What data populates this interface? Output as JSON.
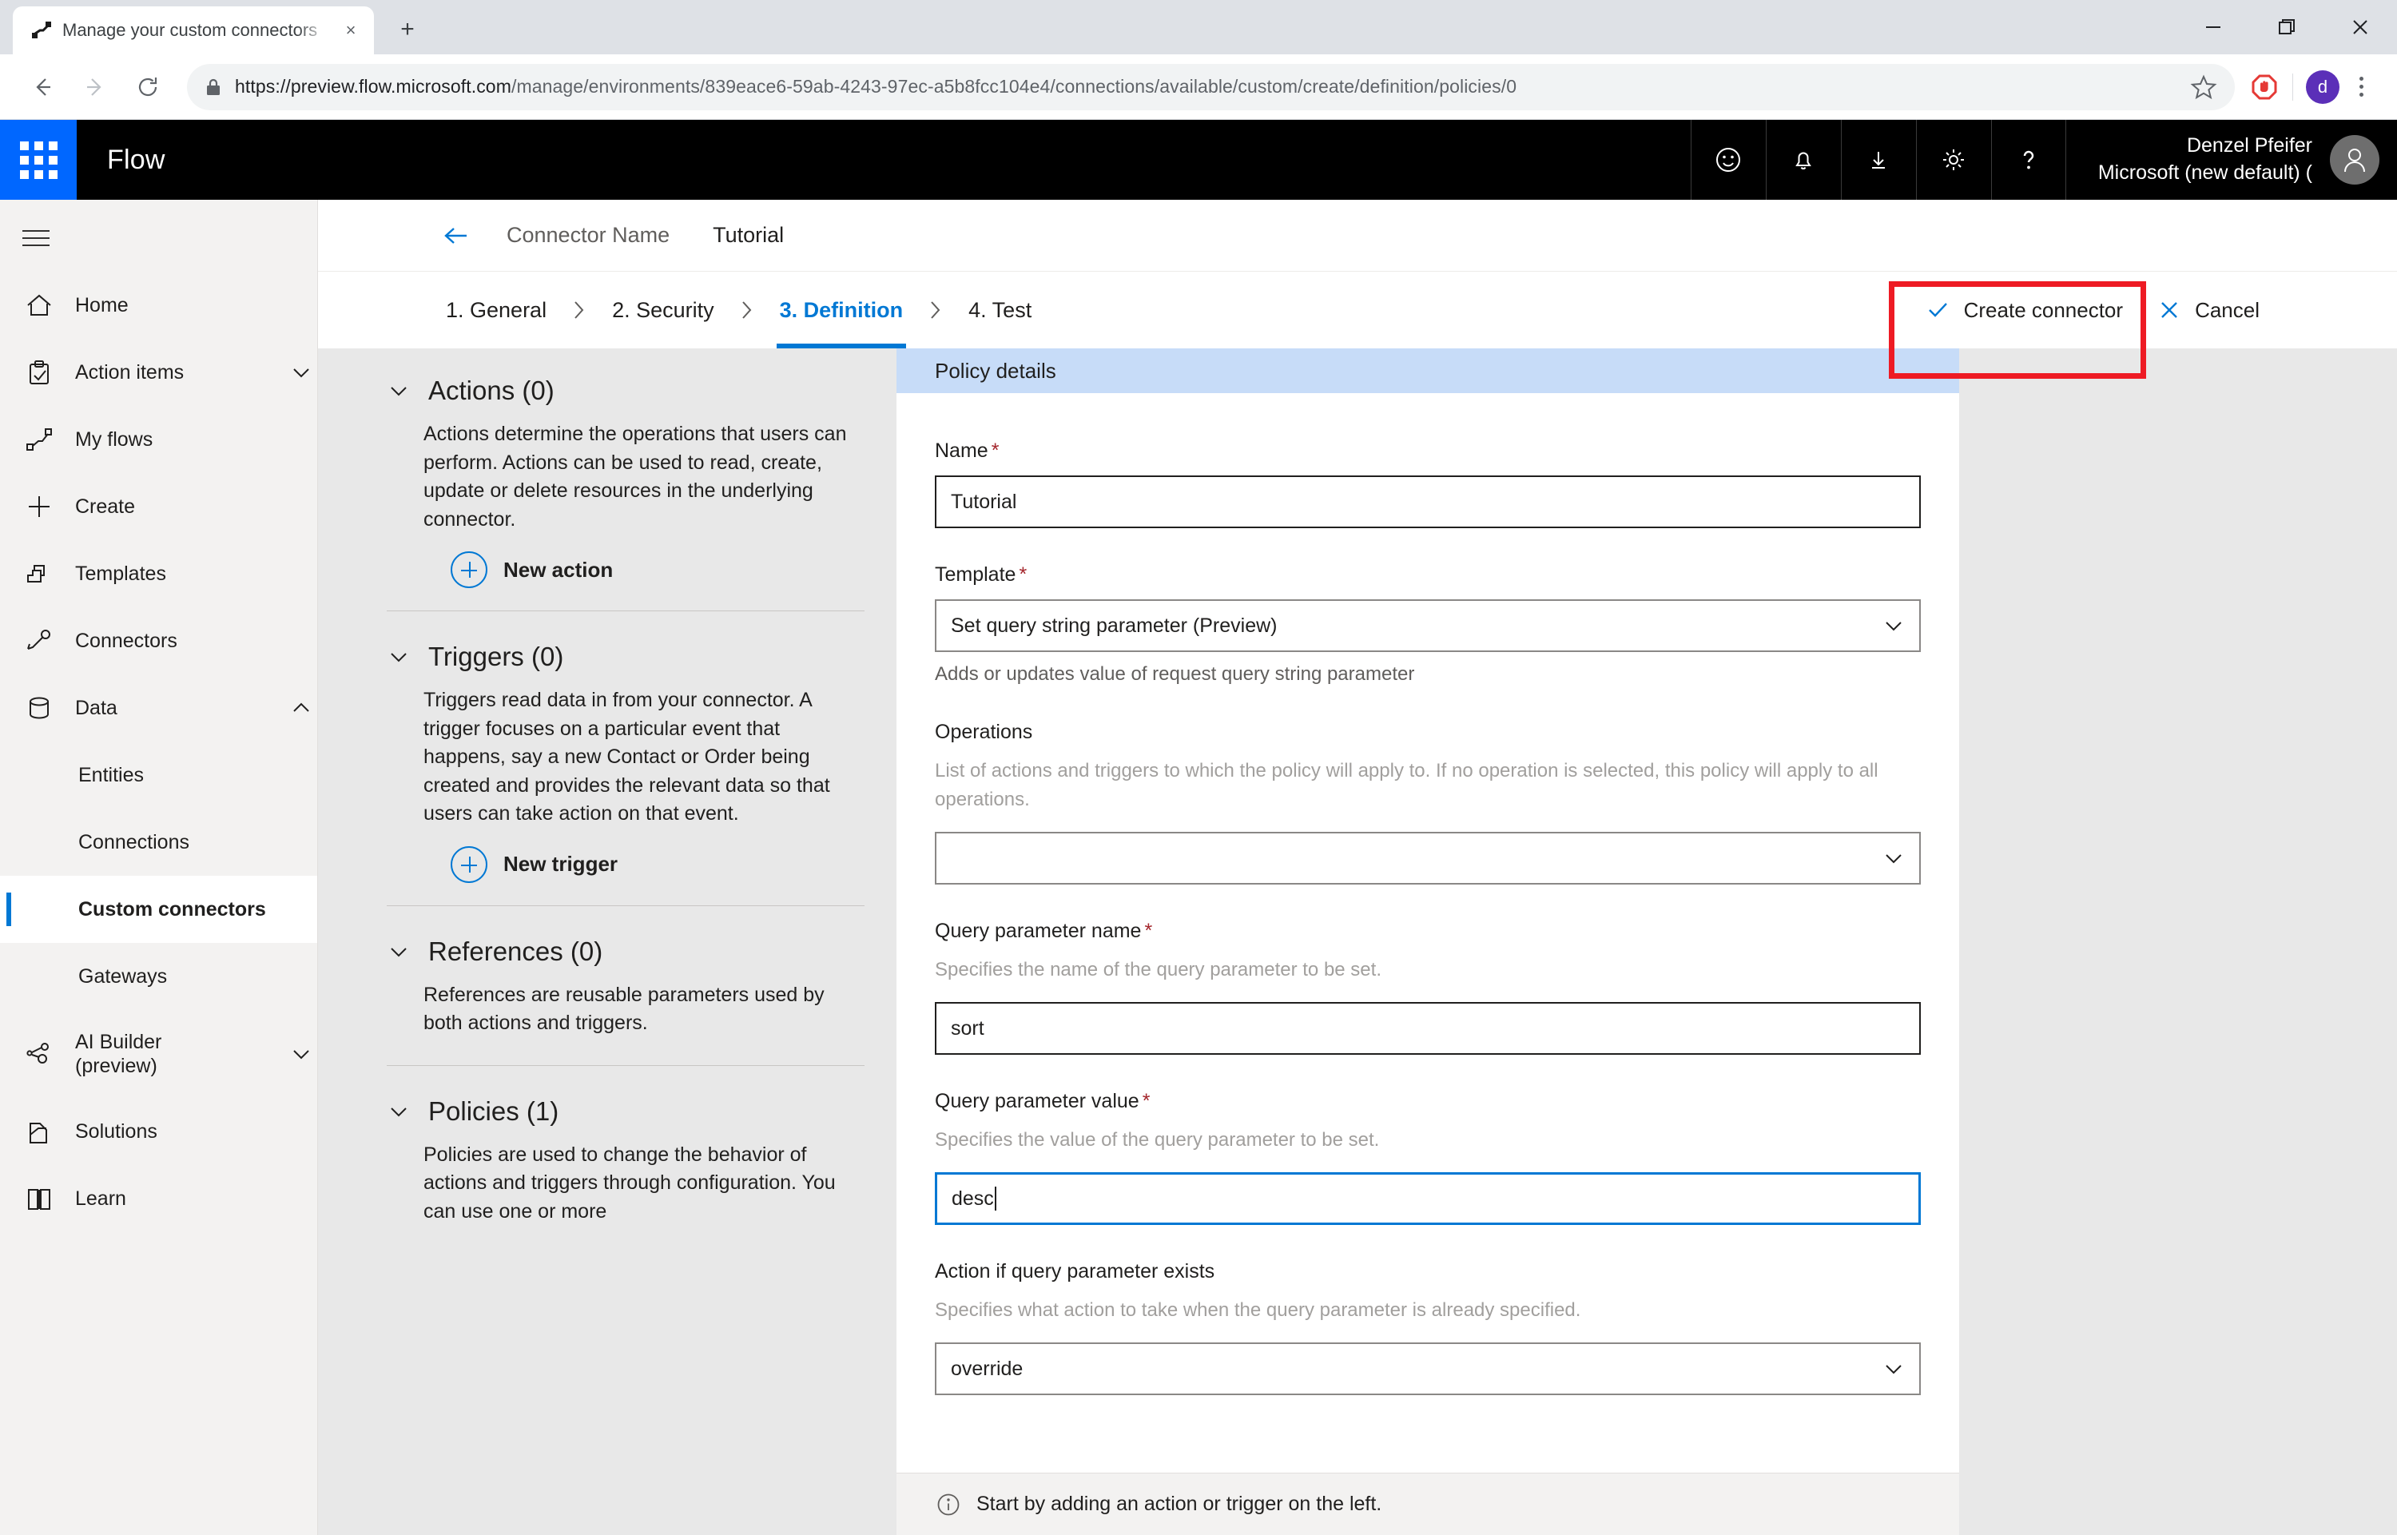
{
  "browser": {
    "tab": {
      "title": "Manage your custom connectors",
      "favicon": "flow-favicon",
      "close": "×"
    },
    "newtab_label": "+",
    "window_controls": {
      "minimize": "minimize-icon",
      "maximize": "maximize-icon",
      "close": "close-icon"
    },
    "url_scheme_domain": "https://preview.flow.microsoft.com",
    "url_path": "/manage/environments/839eace6-59ab-4243-97ec-a5b8fcc104e4/connections/available/custom/create/definition/policies/0",
    "profile_initial": "d"
  },
  "app_header": {
    "brand": "Flow",
    "icons": [
      "smiley-icon",
      "bell-icon",
      "download-icon",
      "gear-icon",
      "help-icon"
    ],
    "user_name": "Denzel Pfeifer",
    "user_org": "Microsoft (new default) ("
  },
  "sidebar": {
    "items": [
      {
        "label": "Home",
        "icon": "home-icon",
        "chevron": "",
        "selected": false,
        "sub": false
      },
      {
        "label": "Action items",
        "icon": "clipboard-check-icon",
        "chevron": "down",
        "selected": false,
        "sub": false
      },
      {
        "label": "My flows",
        "icon": "flow-icon",
        "chevron": "",
        "selected": false,
        "sub": false
      },
      {
        "label": "Create",
        "icon": "plus-icon",
        "chevron": "",
        "selected": false,
        "sub": false
      },
      {
        "label": "Templates",
        "icon": "templates-icon",
        "chevron": "",
        "selected": false,
        "sub": false
      },
      {
        "label": "Connectors",
        "icon": "connectors-icon",
        "chevron": "",
        "selected": false,
        "sub": false
      },
      {
        "label": "Data",
        "icon": "database-icon",
        "chevron": "up",
        "selected": false,
        "sub": false
      },
      {
        "label": "Entities",
        "icon": "",
        "chevron": "",
        "selected": false,
        "sub": true
      },
      {
        "label": "Connections",
        "icon": "",
        "chevron": "",
        "selected": false,
        "sub": true
      },
      {
        "label": "Custom connectors",
        "icon": "",
        "chevron": "",
        "selected": true,
        "sub": true
      },
      {
        "label": "Gateways",
        "icon": "",
        "chevron": "",
        "selected": false,
        "sub": true
      },
      {
        "label": "AI Builder (preview)",
        "icon": "ai-builder-icon",
        "chevron": "down",
        "selected": false,
        "sub": false
      },
      {
        "label": "Solutions",
        "icon": "solutions-icon",
        "chevron": "",
        "selected": false,
        "sub": false
      },
      {
        "label": "Learn",
        "icon": "book-icon",
        "chevron": "",
        "selected": false,
        "sub": false
      }
    ]
  },
  "breadcrumb": {
    "back_icon": "back-arrow-icon",
    "connector_label": "Connector Name",
    "connector_value": "Tutorial"
  },
  "steps": {
    "separator": "›",
    "items": [
      {
        "label": "1. General",
        "active": false
      },
      {
        "label": "2. Security",
        "active": false
      },
      {
        "label": "3. Definition",
        "active": true
      },
      {
        "label": "4. Test",
        "active": false
      }
    ]
  },
  "commands": {
    "create_label": "Create connector",
    "create_icon": "check-icon",
    "cancel_label": "Cancel",
    "cancel_icon": "close-x-icon",
    "highlight_color": "#ee1b24"
  },
  "left_pane": {
    "sections": [
      {
        "title": "Actions (0)",
        "description": "Actions determine the operations that users can perform. Actions can be used to read, create, update or delete resources in the underlying connector.",
        "button": "New action",
        "rule": true
      },
      {
        "title": "Triggers (0)",
        "description": "Triggers read data in from your connector. A trigger focuses on a particular event that happens, say a new Contact or Order being created and provides the relevant data so that users can take action on that event.",
        "button": "New trigger",
        "rule": true
      },
      {
        "title": "References (0)",
        "description": "References are reusable parameters used by both actions and triggers.",
        "button": "",
        "rule": true
      },
      {
        "title": "Policies (1)",
        "description": "Policies are used to change the behavior of actions and triggers through configuration. You can use one or more",
        "button": "",
        "rule": false
      }
    ]
  },
  "form": {
    "banner": "Policy details",
    "fields": [
      {
        "label": "Name",
        "required": true,
        "help": "",
        "type": "text",
        "value": "Tutorial",
        "focused": false,
        "sub": ""
      },
      {
        "label": "Template",
        "required": true,
        "help": "",
        "type": "select",
        "value": "Set query string parameter (Preview)",
        "focused": false,
        "sub": "Adds or updates value of request query string parameter"
      },
      {
        "label": "Operations",
        "required": false,
        "help": "List of actions and triggers to which the policy will apply to. If no operation is selected, this policy will apply to all operations.",
        "type": "select",
        "value": "",
        "focused": false,
        "sub": ""
      },
      {
        "label": "Query parameter name",
        "required": true,
        "help": "Specifies the name of the query parameter to be set.",
        "type": "text",
        "value": "sort",
        "focused": false,
        "sub": ""
      },
      {
        "label": "Query parameter value",
        "required": true,
        "help": "Specifies the value of the query parameter to be set.",
        "type": "text",
        "value": "desc",
        "focused": true,
        "sub": ""
      },
      {
        "label": "Action if query parameter exists",
        "required": false,
        "help": "Specifies what action to take when the query parameter is already specified.",
        "type": "select",
        "value": "override",
        "focused": false,
        "sub": ""
      }
    ]
  },
  "status": {
    "icon": "info-icon",
    "text": "Start by adding an action or trigger on the left."
  }
}
